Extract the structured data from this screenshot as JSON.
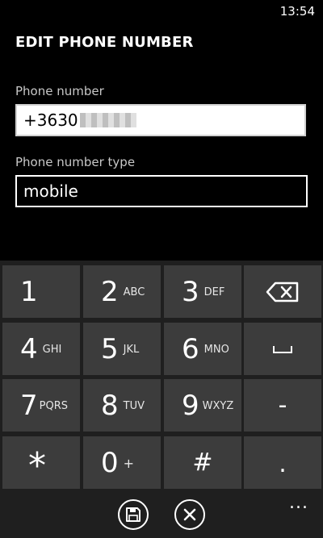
{
  "status": {
    "time": "13:54"
  },
  "header": {
    "title": "EDIT PHONE NUMBER"
  },
  "phone": {
    "label": "Phone number",
    "value": "+3630"
  },
  "type": {
    "label": "Phone number type",
    "value": "mobile"
  },
  "keypad": {
    "row1": [
      {
        "digit": "1",
        "letters": ""
      },
      {
        "digit": "2",
        "letters": "ABC"
      },
      {
        "digit": "3",
        "letters": "DEF"
      }
    ],
    "row2": [
      {
        "digit": "4",
        "letters": "GHI"
      },
      {
        "digit": "5",
        "letters": "JKL"
      },
      {
        "digit": "6",
        "letters": "MNO"
      }
    ],
    "row3": [
      {
        "digit": "7",
        "letters": "PQRS"
      },
      {
        "digit": "8",
        "letters": "TUV"
      },
      {
        "digit": "9",
        "letters": "WXYZ"
      }
    ],
    "row4": [
      {
        "digit": "*",
        "letters": ""
      },
      {
        "digit": "0",
        "letters": "+"
      },
      {
        "digit": "#",
        "letters": ""
      }
    ],
    "dash": "-",
    "dot": "."
  },
  "appbar": {
    "more": "..."
  }
}
